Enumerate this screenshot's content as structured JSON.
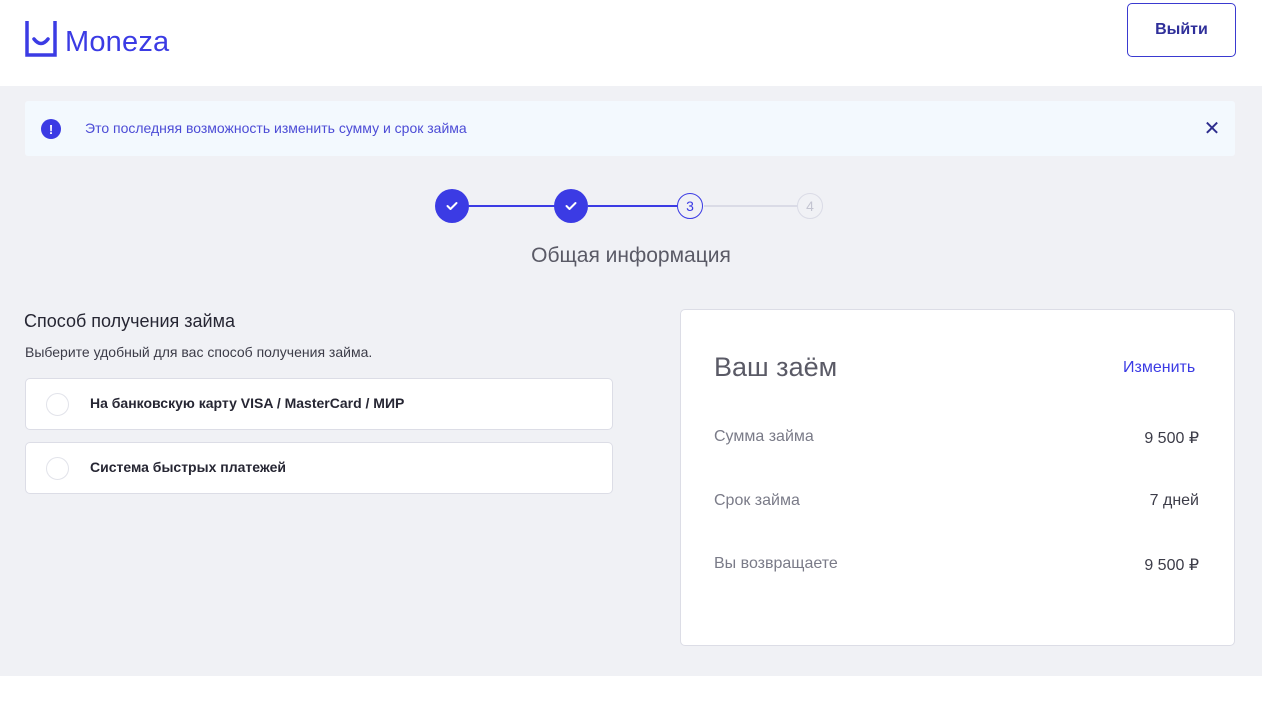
{
  "header": {
    "logo_text": "Moneza",
    "logout_label": "Выйти"
  },
  "alert": {
    "icon": "exclamation-icon",
    "text": "Это последняя возможность изменить сумму и срок займа",
    "close_icon": "close-icon"
  },
  "stepper": {
    "steps": [
      {
        "state": "done",
        "icon": "check-icon"
      },
      {
        "state": "done",
        "icon": "check-icon"
      },
      {
        "state": "current",
        "label": "3"
      },
      {
        "state": "future",
        "label": "4"
      }
    ],
    "title": "Общая информация"
  },
  "receive_method": {
    "title": "Способ получения займа",
    "subtitle": "Выберите удобный для вас способ получения займа.",
    "options": [
      {
        "label": "На банковскую карту VISA / MasterCard / МИР",
        "selected": false
      },
      {
        "label": "Система быстрых платежей",
        "selected": false
      }
    ]
  },
  "loan": {
    "title": "Ваш заём",
    "edit_label": "Изменить",
    "rows": [
      {
        "label": "Сумма займа",
        "value": "9 500 ₽"
      },
      {
        "label": "Срок займа",
        "value": "7 дней"
      },
      {
        "label": "Вы возвращаете",
        "value": "9 500 ₽"
      }
    ]
  },
  "colors": {
    "accent": "#3b3be4",
    "background": "#f0f1f5",
    "alert_bg": "#f3f9fe"
  }
}
